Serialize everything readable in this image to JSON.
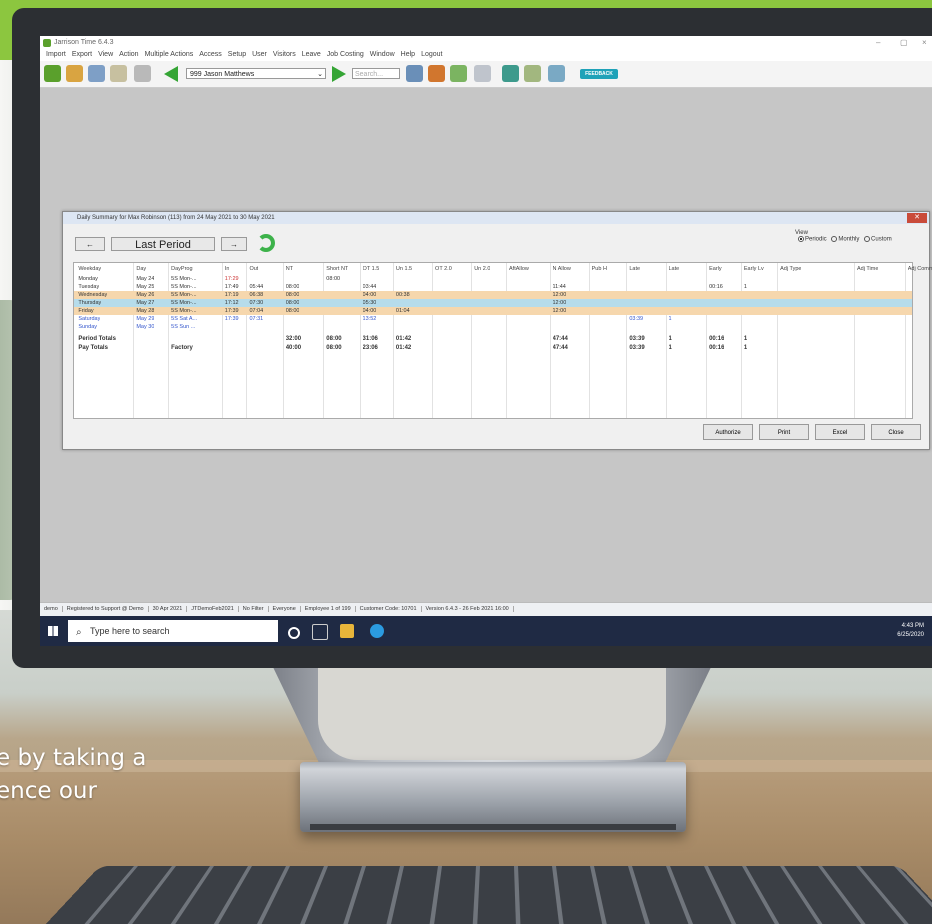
{
  "app": {
    "title": "Jarrison Time 6.4.3",
    "menu": [
      "Import",
      "Export",
      "View",
      "Action",
      "Multiple Actions",
      "Access",
      "Setup",
      "User",
      "Visitors",
      "Leave",
      "Job Costing",
      "Window",
      "Help",
      "Logout"
    ],
    "employee_selected": "999 Jason Matthews",
    "search_placeholder": "Search...",
    "feedback_label": "FEEDBACK",
    "window_controls": [
      "–",
      "▢",
      "×"
    ]
  },
  "dialog": {
    "title": "Daily Summary for Max Robinson (113)  from 24 May 2021  to  30 May 2021",
    "close_label": "✕",
    "prev_label": "←",
    "period_label": "Last Period",
    "next_label": "→",
    "view": {
      "label": "View",
      "options": [
        "Periodic",
        "Monthly",
        "Custom"
      ],
      "selected": "Periodic"
    },
    "columns": [
      "Weekday",
      "Day",
      "DayProg",
      "In",
      "Out",
      "NT",
      "Short NT",
      "OT 1.5",
      "Un 1.5",
      "OT 2.0",
      "Un 2.0",
      "AftAllow",
      "N Allow",
      "Pub H",
      "Late",
      "Late",
      "Early",
      "Early Lv",
      "Adj Type",
      "Adj Time",
      "Adj Comment"
    ],
    "rows": [
      {
        "weekday": "Monday",
        "day": "May 24",
        "dayprog": "5S Mon-...",
        "in": "17:29",
        "out": "",
        "nt": "",
        "short_nt": "08:00",
        "ot15": "",
        "un15": "",
        "nallow": "",
        "late": "",
        "late2": "",
        "early": "",
        "earlylv": "",
        "style": "plain"
      },
      {
        "weekday": "Tuesday",
        "day": "May 25",
        "dayprog": "5S Mon-...",
        "in": "17:49",
        "out": "05:44",
        "nt": "08:00",
        "short_nt": "",
        "ot15": "03:44",
        "un15": "",
        "nallow": "11:44",
        "late": "",
        "late2": "",
        "early": "00:16",
        "earlylv": "1",
        "style": "plain"
      },
      {
        "weekday": "Wednesday",
        "day": "May 26",
        "dayprog": "5S Mon-...",
        "in": "17:19",
        "out": "06:38",
        "nt": "08:00",
        "short_nt": "",
        "ot15": "04:00",
        "un15": "00:38",
        "nallow": "12:00",
        "late": "",
        "late2": "",
        "early": "",
        "earlylv": "",
        "style": "orange"
      },
      {
        "weekday": "Thursday",
        "day": "May 27",
        "dayprog": "5S Mon-...",
        "in": "17:12",
        "out": "07:30",
        "nt": "08:00",
        "short_nt": "",
        "ot15": "05:30",
        "un15": "",
        "nallow": "12:00",
        "late": "",
        "late2": "",
        "early": "",
        "earlylv": "",
        "style": "blue"
      },
      {
        "weekday": "Friday",
        "day": "May 28",
        "dayprog": "5S Mon-...",
        "in": "17:39",
        "out": "07:04",
        "nt": "08:00",
        "short_nt": "",
        "ot15": "04:00",
        "un15": "01:04",
        "nallow": "12:00",
        "late": "",
        "late2": "",
        "early": "",
        "earlylv": "",
        "style": "orange"
      },
      {
        "weekday": "Saturday",
        "day": "May 29",
        "dayprog": "5S Sat A...",
        "in": "17:39",
        "out": "07:31",
        "nt": "",
        "short_nt": "",
        "ot15": "13:52",
        "un15": "",
        "nallow": "",
        "late": "03:39",
        "late2": "1",
        "early": "",
        "earlylv": "",
        "style": "weekend"
      },
      {
        "weekday": "Sunday",
        "day": "May 30",
        "dayprog": "5S Sun ...",
        "in": "",
        "out": "",
        "nt": "",
        "short_nt": "",
        "ot15": "",
        "un15": "",
        "nallow": "",
        "late": "",
        "late2": "",
        "early": "",
        "earlylv": "",
        "style": "weekend"
      }
    ],
    "totals": [
      {
        "label": "Period Totals",
        "dayprog": "",
        "nt": "32:00",
        "short_nt": "08:00",
        "ot15": "31:06",
        "un15": "01:42",
        "nallow": "47:44",
        "late": "03:39",
        "late2": "1",
        "early": "00:16",
        "earlylv": "1"
      },
      {
        "label": "Pay Totals",
        "dayprog": "Factory",
        "nt": "40:00",
        "short_nt": "08:00",
        "ot15": "23:06",
        "un15": "01:42",
        "nallow": "47:44",
        "late": "03:39",
        "late2": "1",
        "early": "00:16",
        "earlylv": "1"
      }
    ],
    "buttons": [
      "Authorize",
      "Print",
      "Excel",
      "Close"
    ]
  },
  "statusbar": [
    "demo",
    "Registered to Support @ Demo",
    "30 Apr 2021",
    "JTDemoFeb2021",
    "No Filter",
    "Everyone",
    "Employee 1 of 199",
    "Customer Code: 10701",
    "Version 6.4.3 - 26 Feb 2021 16:00"
  ],
  "taskbar": {
    "search_placeholder": "Type here to search",
    "time": "4:43 PM",
    "date": "6/25/2020"
  },
  "promo_text": "e by taking a\nence our",
  "colors": {
    "orange_row": "#f6d7ad",
    "blue_row": "#b6dceb",
    "weekend_text": "#3355cc",
    "late_text": "#cc3333",
    "accent_green": "#8cc63f"
  }
}
